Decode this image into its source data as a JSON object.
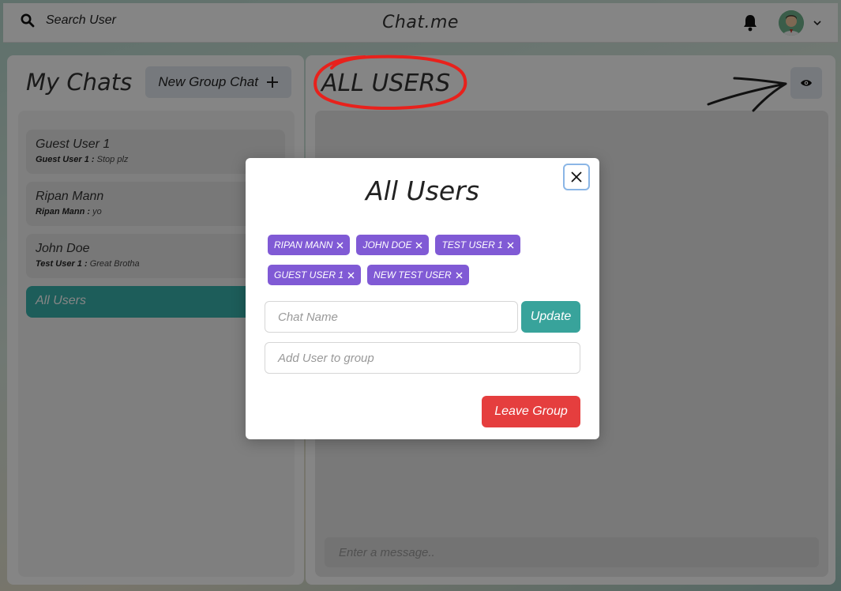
{
  "topbar": {
    "search_label": "Search User",
    "brand": "Chat.me",
    "icons": [
      "search-icon",
      "bell-icon",
      "avatar",
      "chevron-down-icon"
    ]
  },
  "sidebar": {
    "title": "My Chats",
    "new_group_label": "New Group Chat",
    "chats": [
      {
        "name": "Guest User 1",
        "sender": "Guest User 1 :",
        "message": "Stop plz"
      },
      {
        "name": "Ripan Mann",
        "sender": "Ripan Mann :",
        "message": "yo"
      },
      {
        "name": "John Doe",
        "sender": "Test User 1 :",
        "message": "Great Brotha"
      },
      {
        "name": "All Users"
      }
    ],
    "active_chat": "All Users"
  },
  "chat": {
    "title": "ALL USERS",
    "message_placeholder": "Enter a message.."
  },
  "modal": {
    "title": "All Users",
    "members": [
      "RIPAN MANN",
      "JOHN DOE",
      "TEST USER 1",
      "GUEST USER 1",
      "NEW TEST USER"
    ],
    "chat_name_placeholder": "Chat Name",
    "update_label": "Update",
    "add_user_placeholder": "Add User to group",
    "leave_label": "Leave Group"
  },
  "colors": {
    "accent_teal": "#38b2ac",
    "badge_purple": "#805ad5",
    "danger_red": "#e53e3e",
    "annotation_red": "#e8211c"
  }
}
